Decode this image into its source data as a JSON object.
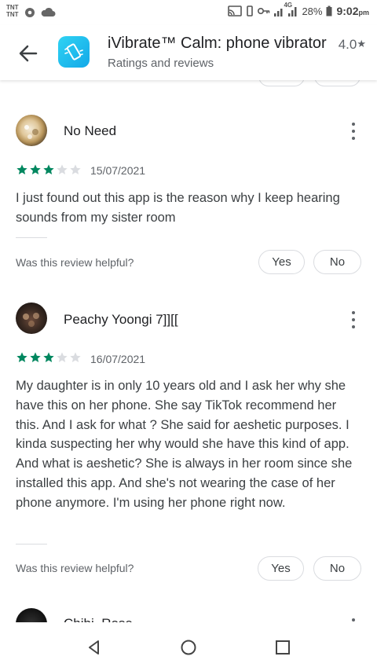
{
  "status_bar": {
    "carrier_1": "TNT",
    "carrier_2": "TNT",
    "network": "4G",
    "battery": "28%",
    "time": "9:02",
    "ampm": "pm"
  },
  "header": {
    "app_title": "iVibrate™ Calm: phone vibrator",
    "subtitle": "Ratings and reviews",
    "rating": "4.0",
    "rating_star": "★"
  },
  "colors": {
    "star_filled": "#01875f",
    "star_empty": "#dadce0",
    "app_icon": "#1cb8ee"
  },
  "reviews": [
    {
      "name": "No Need",
      "rating": 3,
      "date": "15/07/2021",
      "text": "I just found out this app is the reason why I keep hearing sounds from my sister room",
      "helpful_prompt": "Was this review helpful?",
      "yes_label": "Yes",
      "no_label": "No"
    },
    {
      "name": "Peachy Yoongi 7]][[",
      "rating": 3,
      "date": "16/07/2021",
      "text": "My daughter is in only 10 years old and I ask her why she have this on her phone. She say TikTok recommend her this. And I ask for what ? She said for aeshetic purposes. I kinda suspecting her why would she have this kind of app. And what is aeshetic? She is always in her room since she installed this app. And she's not wearing the case of her phone anymore. I'm using her phone right now.",
      "helpful_prompt": "Was this review helpful?",
      "yes_label": "Yes",
      "no_label": "No"
    },
    {
      "name": "Chibi_Rose"
    }
  ]
}
